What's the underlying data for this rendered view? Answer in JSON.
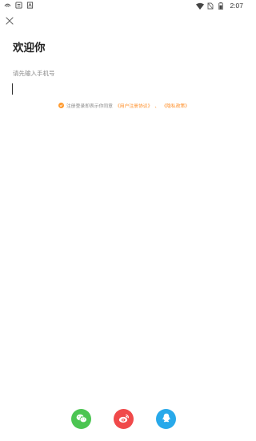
{
  "statusbar": {
    "time": "2:07",
    "left_icons": [
      "signal-icon",
      "bug-icon",
      "notification-icon"
    ],
    "right_icons": [
      "wifi-icon",
      "no-sim-icon",
      "battery-icon"
    ]
  },
  "title": "欢迎你",
  "phone": {
    "label": "请先输入手机号",
    "value": ""
  },
  "agreement": {
    "prefix": "注册登录即表示你同意",
    "user_agreement": "《用户注册协议》",
    "separator": "、",
    "privacy_policy": "《隐私政策》"
  },
  "social": {
    "icons": [
      "wechat-icon",
      "weibo-icon",
      "qq-icon"
    ],
    "colors": {
      "wechat": "#4cc552",
      "weibo": "#f0494a",
      "qq": "#28a9ea"
    }
  },
  "colors": {
    "accent": "#ff8a1f",
    "check": "#ff9a2e"
  }
}
